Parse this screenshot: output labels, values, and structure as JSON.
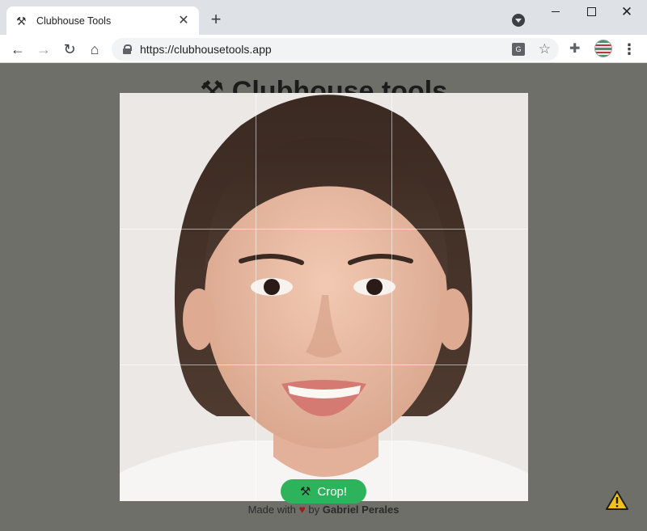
{
  "browser": {
    "tab": {
      "title": "Clubhouse Tools",
      "favicon": "tools-icon",
      "close_glyph": "✕"
    },
    "new_tab_glyph": "+",
    "url": "https://clubhousetools.app",
    "window_close_glyph": "✕"
  },
  "page": {
    "title": "⚒ Clubhouse tools",
    "crop_button_label": "Crop!",
    "footer": {
      "prefix": "Made with",
      "heart": "♥",
      "by": "by",
      "author": "Gabriel Perales"
    }
  },
  "colors": {
    "page_bg": "#6f6f69",
    "button_green": "#2eb35d",
    "heart_red": "#9b1c1c"
  }
}
